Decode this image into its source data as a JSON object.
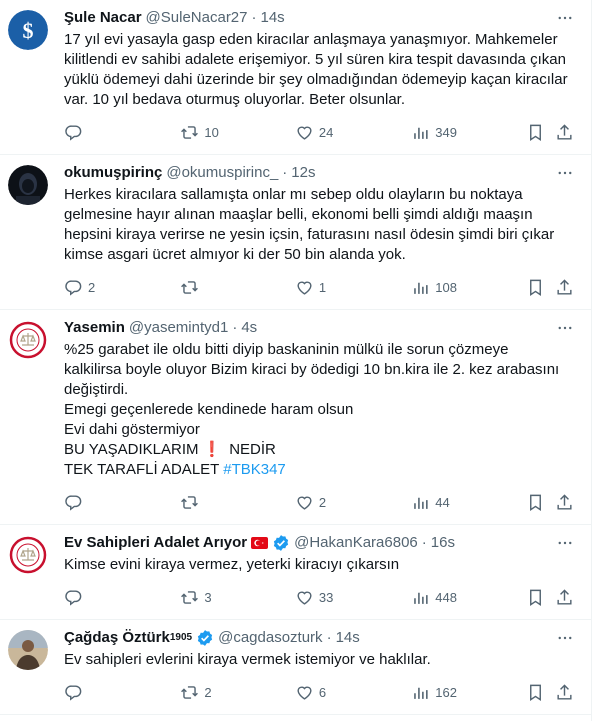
{
  "tweets": [
    {
      "name": "Şule Nacar",
      "handle": "@SuleNacar27",
      "time": "14s",
      "lines": [
        "17 yıl evi yasayla gasp eden kiracılar anlaşmaya yanaşmıyor. Mahkemeler",
        "kilitlendi ev sahibi adalete erişemiyor. 5 yıl süren kira tespit davasında çıkan",
        "yüklü ödemeyi dahi üzerinde bir şey olmadığından ödemeyip kaçan kiracılar",
        "var. 10 yıl bedava oturmuş oluyorlar. Beter olsunlar."
      ],
      "replies": "",
      "retweets": "10",
      "likes": "24",
      "views": "349"
    },
    {
      "name": "okumuşpirinç",
      "handle": "@okumuspirinc_",
      "time": "12s",
      "lines": [
        "Herkes kiracılara sallamışta onlar mı sebep oldu olayların bu noktaya",
        "gelmesine hayır alınan maaşlar belli, ekonomi belli şimdi aldığı maaşın",
        "hepsini kiraya verirse ne yesin içsin, faturasını nasıl ödesin şimdi biri çıkar",
        "kimse asgari ücret almıyor ki der 50 bin alanda yok."
      ],
      "replies": "2",
      "retweets": "",
      "likes": "1",
      "views": "108"
    },
    {
      "name": "Yasemin",
      "handle": "@yasemintyd1",
      "time": "4s",
      "lines": [
        "%25 garabet ile oldu bitti diyip baskaninin mülkü ile sorun çözmeye",
        "kalkilirsa boyle oluyor Bizim kiraci by ödedigi 10 bn.kira ile 2. kez arabasını",
        "değiştirdi.",
        "Emegi geçenlerede kendinede haram olsun",
        "Evi dahi göstermiyor"
      ],
      "line6_a": "BU YAŞADIKLARIM",
      "line6_bang": "❗",
      "line6_b": "NEDİR",
      "line7_a": "TEK TARAFLİ ADALET",
      "hashtag": "#TBK347",
      "replies": "",
      "retweets": "",
      "likes": "2",
      "views": "44"
    },
    {
      "name": "Ev Sahipleri Adalet Arıyor",
      "handle": "@HakanKara6806",
      "time": "16s",
      "lines": [
        "Kimse evini kiraya vermez, yeterki kiracıyı çıkarsın"
      ],
      "replies": "",
      "retweets": "3",
      "likes": "33",
      "views": "448"
    },
    {
      "name": "Çağdaş Öztürk",
      "name_sup": "1905",
      "handle": "@cagdasozturk",
      "time": "14s",
      "lines": [
        "Ev sahipleri evlerini kiraya vermek istemiyor ve haklılar."
      ],
      "replies": "",
      "retweets": "2",
      "likes": "6",
      "views": "162"
    }
  ],
  "dot": "·",
  "colors": {
    "accent": "#1d9bf0",
    "muted": "#536471",
    "text": "#0f1419",
    "flag": "#e30a17"
  },
  "icons": [
    "reply-icon",
    "retweet-icon",
    "like-icon",
    "views-icon",
    "bookmark-icon",
    "share-icon",
    "more-icon",
    "verified-badge-icon",
    "turkish-flag-icon"
  ]
}
